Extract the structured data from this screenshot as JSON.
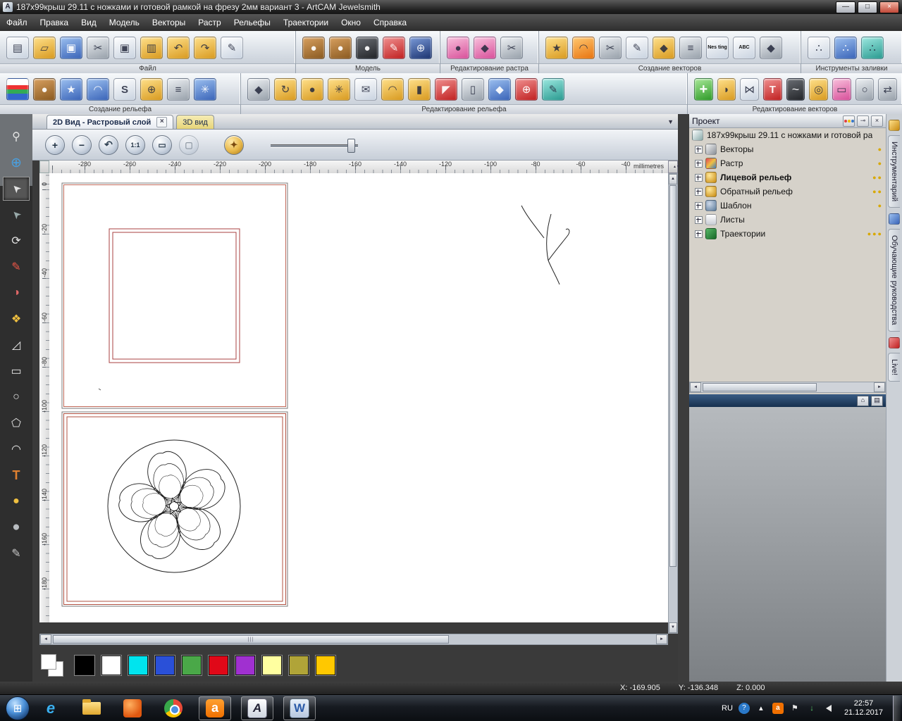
{
  "window_title": "187x99крыш 29.11 с ножками и готовой рамкой на фрезу 2мм вариант 3 - ArtCAM Jewelsmith",
  "glyphs": {
    "app_logo": "A",
    "minimize": "—",
    "maximize": "□",
    "close": "×",
    "tab_close": "×",
    "dropdown": "▼",
    "plus": "+",
    "minus": "−",
    "scroll_up": "▲",
    "scroll_down": "▼",
    "scroll_left": "◄",
    "scroll_right": "►",
    "unit_stepper": "▲▼",
    "home": "⌂",
    "detach": "▤",
    "caret_up": "▴",
    "help": "?",
    "flag": "⚑",
    "down_arrow": "↓",
    "window_grid": "⊞"
  },
  "menu": {
    "items": [
      "Файл",
      "Правка",
      "Вид",
      "Модель",
      "Векторы",
      "Растр",
      "Рельефы",
      "Траектории",
      "Окно",
      "Справка"
    ]
  },
  "toolbar_row1": {
    "groups": [
      {
        "label": "Файл",
        "icons": [
          {
            "name": "new-model-icon",
            "cls": "ib c-white g-page"
          },
          {
            "name": "open-file-icon",
            "cls": "ib c-gold g-folder"
          },
          {
            "name": "save-icon",
            "cls": "ib c-blue g-disk"
          },
          {
            "name": "cut-icon",
            "cls": "ib c-silver g-cut"
          },
          {
            "name": "copy-icon",
            "cls": "ib c-white g-copy"
          },
          {
            "name": "paste-icon",
            "cls": "ib c-gold g-paste"
          },
          {
            "name": "undo-icon",
            "cls": "ib c-gold g-undo"
          },
          {
            "name": "redo-icon",
            "cls": "ib c-gold g-redo"
          },
          {
            "name": "annotate-icon",
            "cls": "ib c-white g-pencil"
          }
        ]
      },
      {
        "label": "Модель",
        "icons": [
          {
            "name": "model-preview-icon",
            "cls": "ib c-brown g-blob"
          },
          {
            "name": "model-add-icon",
            "cls": "ib c-brown g-blob"
          },
          {
            "name": "model-invert-icon",
            "cls": "ib c-dark g-blob"
          },
          {
            "name": "model-lighting-icon",
            "cls": "ib c-red g-pencil"
          },
          {
            "name": "model-wireframe-icon",
            "cls": "ib c-navy g-globe"
          }
        ]
      },
      {
        "label": "Редактирование растра",
        "icons": [
          {
            "name": "reduce-colours-icon",
            "cls": "ib c-pink g-blob"
          },
          {
            "name": "bitmap-shape-icon",
            "cls": "ib c-pink g-diamond"
          },
          {
            "name": "bitmap-scissors-icon",
            "cls": "ib c-silver g-cut"
          }
        ]
      },
      {
        "label": "Создание векторов",
        "icons": [
          {
            "name": "wizard-star-icon",
            "cls": "ib c-gold g-star"
          },
          {
            "name": "arc-wizard-icon",
            "cls": "ib c-orange g-arc"
          },
          {
            "name": "vector-knife-icon",
            "cls": "ib c-silver g-cut"
          },
          {
            "name": "fit-vectors-icon",
            "cls": "ib c-white g-pencil"
          },
          {
            "name": "offset-vector-icon",
            "cls": "ib c-gold g-diamond"
          },
          {
            "name": "group-vectors-icon",
            "cls": "ib c-silver g-layers"
          },
          {
            "name": "nesting-icon",
            "cls": "ib c-white",
            "txt": "Nes ting"
          },
          {
            "name": "vector-text-icon",
            "cls": "ib c-white",
            "txt": "ABC"
          },
          {
            "name": "slice-model-icon",
            "cls": "ib c-silver g-diamond"
          }
        ]
      },
      {
        "label": "Инструменты заливки",
        "icons": [
          {
            "name": "fill-grid-icon",
            "cls": "ib c-white g-dots"
          },
          {
            "name": "fill-beads-icon",
            "cls": "ib c-blue g-dots"
          },
          {
            "name": "fill-chain-icon",
            "cls": "ib c-teal g-dots"
          }
        ]
      }
    ]
  },
  "toolbar_row2": {
    "groups": [
      {
        "label": "Создание рельефа",
        "icons": [
          {
            "name": "shape-editor-icon",
            "cls": "ib c-chart"
          },
          {
            "name": "relief-blend-icon",
            "cls": "ib c-brown g-blob"
          },
          {
            "name": "texture-relief-icon",
            "cls": "ib c-blue g-star"
          },
          {
            "name": "two-rail-sweep-icon",
            "cls": "ib c-blue g-arc"
          },
          {
            "name": "spin-relief-icon",
            "cls": "ib c-white g-s"
          },
          {
            "name": "weave-wizard-icon",
            "cls": "ib c-gold g-globe"
          },
          {
            "name": "relief-layers-icon",
            "cls": "ib c-silver g-layers"
          },
          {
            "name": "emboss-relief-icon",
            "cls": "ib c-blue g-burst"
          }
        ]
      },
      {
        "label": "Редактирование рельефа",
        "icons": [
          {
            "name": "relief-select-icon",
            "cls": "ib c-silver g-diamond"
          },
          {
            "name": "smooth-relief-icon",
            "cls": "ib c-gold g-spin"
          },
          {
            "name": "sculpt-icon",
            "cls": "ib c-gold g-blob"
          },
          {
            "name": "dynamic-sculpt-icon",
            "cls": "ib c-gold g-burst"
          },
          {
            "name": "envelope-distort-icon",
            "cls": "ib c-white g-env"
          },
          {
            "name": "warp-relief-icon",
            "cls": "ib c-gold g-arc"
          },
          {
            "name": "lock-relief-icon",
            "cls": "ib c-gold g-lock"
          },
          {
            "name": "erase-relief-icon",
            "cls": "ib c-red g-erase"
          },
          {
            "name": "pillar-relief-icon",
            "cls": "ib c-silver g-pillar"
          },
          {
            "name": "copy-relief-icon",
            "cls": "ib c-blue g-diamond"
          },
          {
            "name": "offset-target-icon",
            "cls": "ib c-red g-target"
          },
          {
            "name": "paint-relief-icon",
            "cls": "ib c-teal g-brush"
          }
        ]
      },
      {
        "label": "Редактирование векторов",
        "icons": [
          {
            "name": "add-node-icon",
            "cls": "ib c-green g-plus"
          },
          {
            "name": "revolve-icon",
            "cls": "ib c-gold g-vase"
          },
          {
            "name": "hourglass-icon",
            "cls": "ib c-white g-hour"
          },
          {
            "name": "vector-doctor-icon",
            "cls": "ib c-red g-t"
          },
          {
            "name": "freeform-icon",
            "cls": "ib c-dark g-wave"
          },
          {
            "name": "bell-icon",
            "cls": "ib c-gold g-bell"
          },
          {
            "name": "frame-icon",
            "cls": "ib c-pink g-frame"
          },
          {
            "name": "trace-icon",
            "cls": "ib c-silver g-lens"
          },
          {
            "name": "replay-icon",
            "cls": "ib c-silver g-sync"
          }
        ]
      }
    ]
  },
  "left_tools": [
    {
      "name": "zoom-tool",
      "glyph": "⚲",
      "cls": "base"
    },
    {
      "name": "pan-globe-tool",
      "glyph": "⊕",
      "cls": "globe"
    },
    {
      "name": "select-tool",
      "glyph": "➤",
      "cls": "act rot"
    },
    {
      "name": "node-edit-tool",
      "glyph": "➤",
      "cls": "rot dim"
    },
    {
      "name": "transform-tool",
      "glyph": "⟳",
      "cls": "base"
    },
    {
      "name": "measure-tool",
      "glyph": "✎",
      "cls": "red"
    },
    {
      "name": "colour-picker-tool",
      "glyph": "◑",
      "cls": "pick"
    },
    {
      "name": "paint-tool",
      "glyph": "❖",
      "cls": "gold"
    },
    {
      "name": "vector-editor-tool",
      "glyph": "◿",
      "cls": "base"
    },
    {
      "name": "rectangle-tool",
      "glyph": "▭",
      "cls": "base"
    },
    {
      "name": "ellipse-tool",
      "glyph": "○",
      "cls": "base"
    },
    {
      "name": "polygon-tool",
      "glyph": "⬠",
      "cls": "base"
    },
    {
      "name": "arc-tool",
      "glyph": "◠",
      "cls": "base"
    },
    {
      "name": "text-tool",
      "glyph": "T",
      "cls": "text"
    },
    {
      "name": "droplet-tool",
      "glyph": "●",
      "cls": "gold"
    },
    {
      "name": "blob-tool",
      "glyph": "●",
      "cls": "gray"
    },
    {
      "name": "sculpt-knife-tool",
      "glyph": "✎",
      "cls": "dark"
    }
  ],
  "tabs": {
    "tab2d": "2D Вид - Растровый слой",
    "tab3d": "3D вид"
  },
  "zoombar": {
    "one_to_one": "1:1"
  },
  "ruler": {
    "unit": "millimetres",
    "h_ticks": [
      "-280",
      "-260",
      "-240",
      "-220",
      "-200",
      "-180",
      "-160",
      "-140",
      "-120",
      "-100",
      "-80",
      "-60",
      "-40"
    ],
    "v_ticks": [
      "0",
      "-20",
      "-40",
      "-60",
      "-80",
      "-100",
      "-120",
      "-140",
      "-160",
      "-180"
    ]
  },
  "project": {
    "title": "Проект",
    "root": "187x99крыш 29.11 с ножками и готовой ра",
    "items": [
      {
        "label": "Векторы",
        "ico": "vectors",
        "bulbs": "●"
      },
      {
        "label": "Растр",
        "ico": "raster",
        "bulbs": "●"
      },
      {
        "label": "Лицевой рельеф",
        "ico": "relief",
        "bold": "1",
        "bulbs": "●●"
      },
      {
        "label": "Обратный рельеф",
        "ico": "relief",
        "bulbs": "●●"
      },
      {
        "label": "Шаблон",
        "ico": "template",
        "bulbs": "●"
      },
      {
        "label": "Листы",
        "ico": "sheets",
        "bulbs": ""
      },
      {
        "label": "Траектории",
        "ico": "toolpaths",
        "bulbs": "●●●"
      }
    ]
  },
  "right_tabs": {
    "toolbox": "Инструментарий",
    "tutorials": "Обучающие руководства",
    "live": "Live!"
  },
  "status": {
    "x": "X: -169.905",
    "y": "Y: -136.348",
    "z": "Z: 0.000"
  },
  "taskbar": {
    "lang": "RU",
    "time": "22:57",
    "date": "21.12.2017",
    "app_glyphs": {
      "ie": "e",
      "amigo": "a",
      "artcam": "A",
      "word": "W"
    }
  },
  "palette": [
    "#000000",
    "#ffffff",
    "#00e4ee",
    "#2a50d8",
    "#4aa848",
    "#e00818",
    "#a030d0",
    "#ffffa0",
    "#b0a438",
    "#ffc800"
  ]
}
